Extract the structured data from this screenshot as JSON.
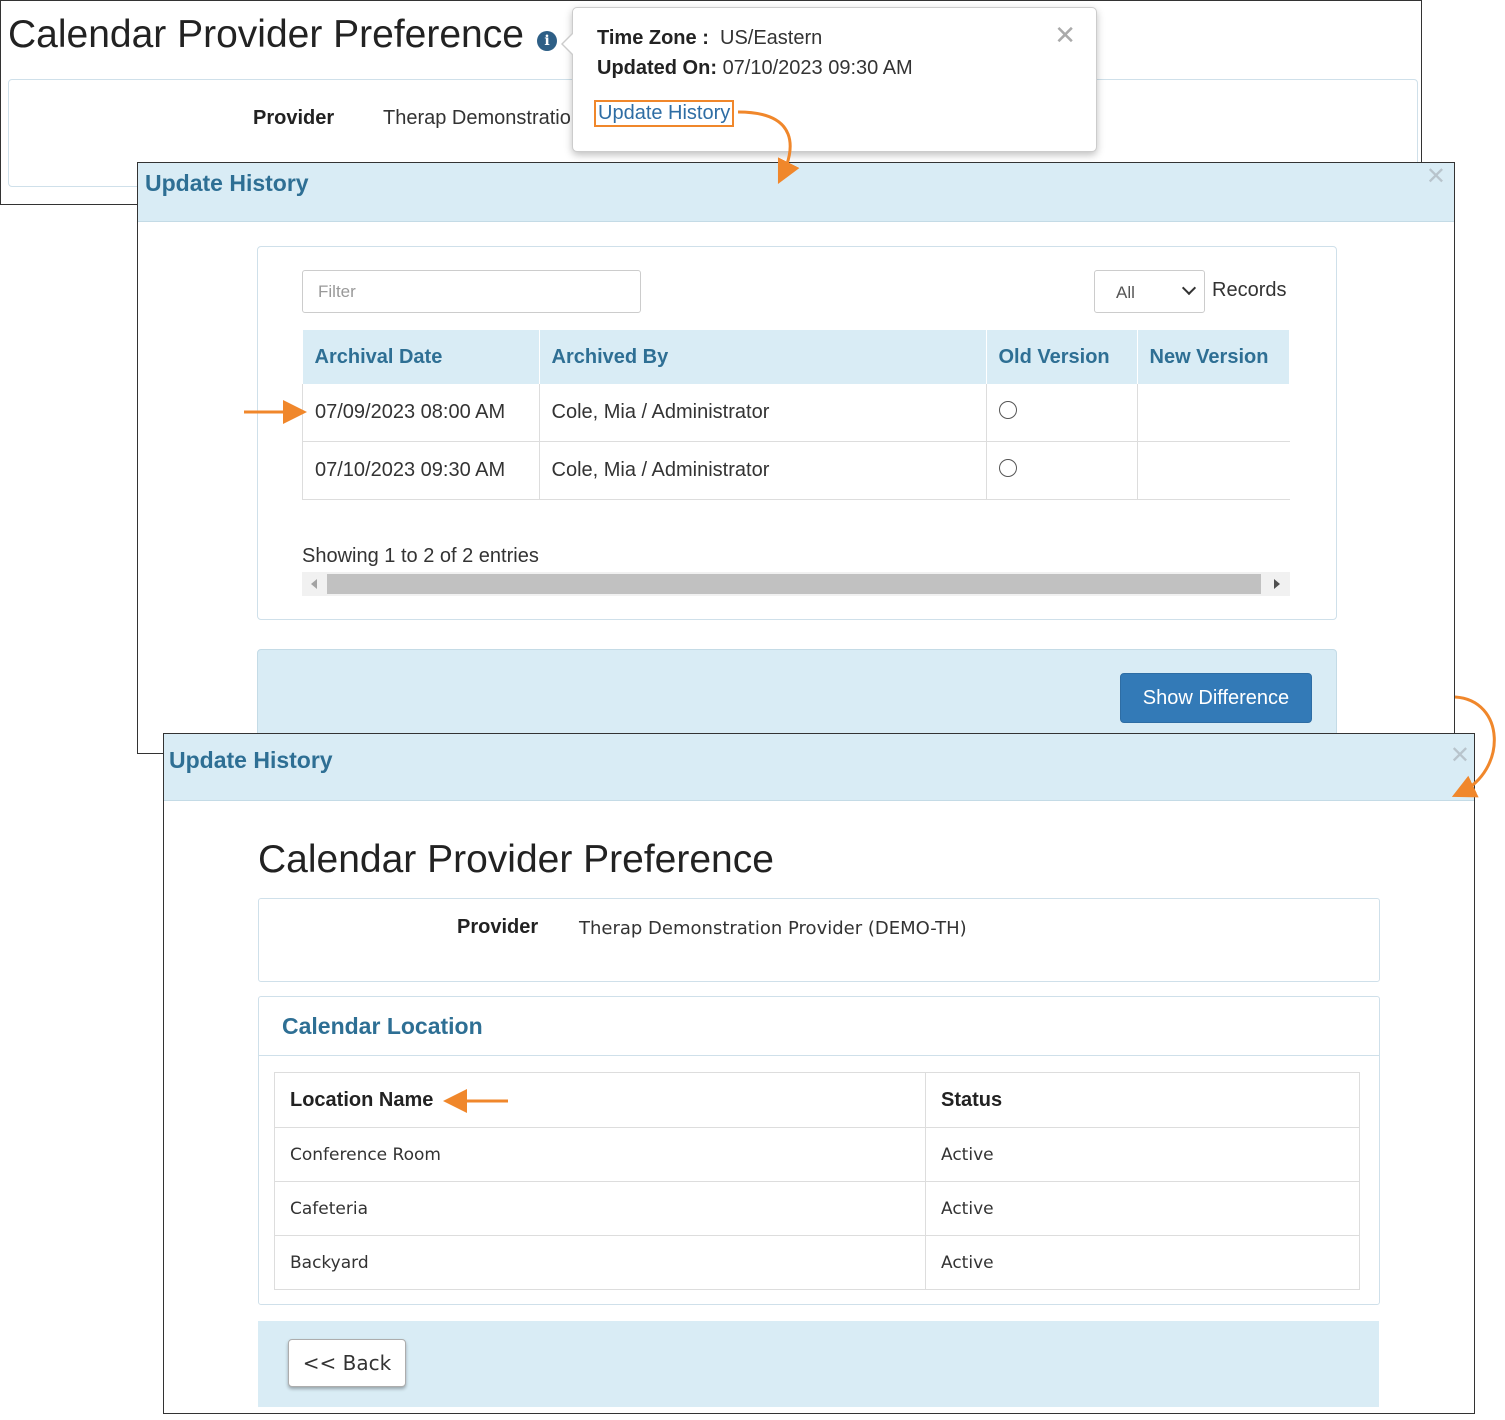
{
  "background_page": {
    "title": "Calendar Provider Preference",
    "info_icon": "info-circle-icon",
    "provider_label": "Provider",
    "provider_value": "Therap Demonstratio"
  },
  "popover": {
    "time_zone_label": "Time Zone :",
    "time_zone_value": "US/Eastern",
    "updated_on_label": "Updated On:",
    "updated_on_value": "07/10/2023 09:30 AM",
    "update_history_link": "Update History",
    "close_icon": "close-icon"
  },
  "history_modal": {
    "title": "Update History",
    "close_icon": "close-icon",
    "filter_placeholder": "Filter",
    "records_select_value": "All",
    "records_label": "Records",
    "columns": [
      "Archival Date",
      "Archived By",
      "Old Version",
      "New Version"
    ],
    "rows": [
      {
        "archival_date": "07/09/2023 08:00 AM",
        "archived_by": "Cole, Mia / Administrator"
      },
      {
        "archival_date": "07/10/2023 09:30 AM",
        "archived_by": "Cole, Mia / Administrator"
      }
    ],
    "showing_text": "Showing 1 to 2 of 2 entries",
    "show_difference_label": "Show Difference"
  },
  "detail_modal": {
    "title": "Update History",
    "close_icon": "close-icon",
    "page_title": "Calendar Provider Preference",
    "provider_label": "Provider",
    "provider_value": "Therap Demonstration Provider (DEMO-TH)",
    "section_title": "Calendar Location",
    "columns": [
      "Location Name",
      "Status"
    ],
    "rows": [
      {
        "name": "Conference Room",
        "status": "Active"
      },
      {
        "name": "Cafeteria",
        "status": "Active"
      },
      {
        "name": "Backyard",
        "status": "Active"
      }
    ],
    "back_label": "<< Back"
  },
  "colors": {
    "header_bg": "#d9ecf5",
    "header_text": "#2e6f94",
    "primary_button": "#337ab7",
    "annotation_orange": "#f0872b"
  }
}
